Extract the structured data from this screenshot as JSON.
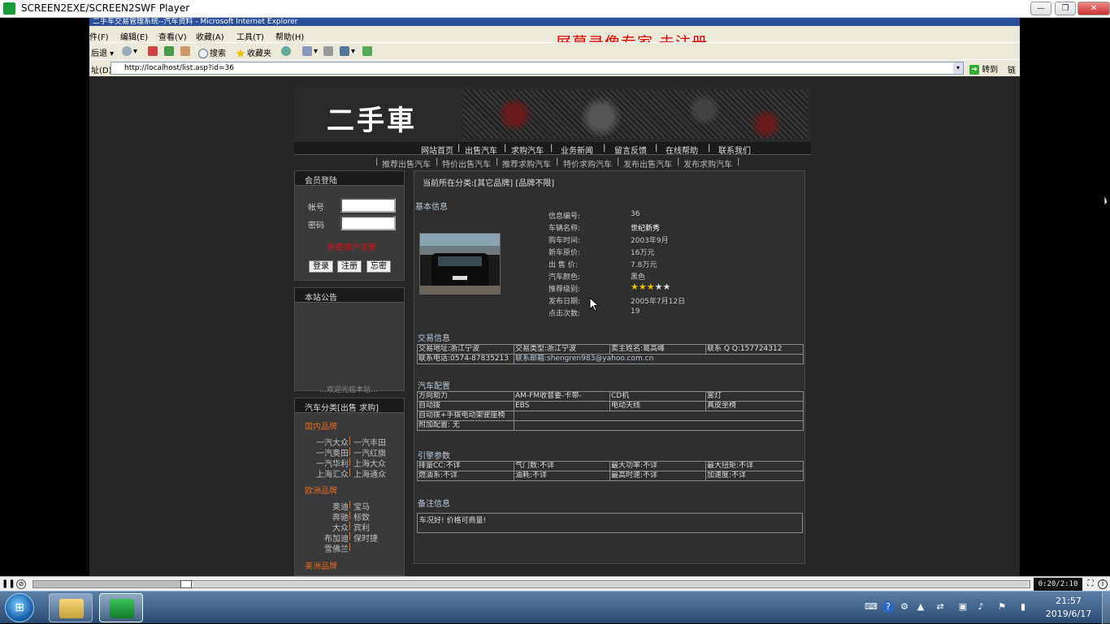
{
  "player": {
    "title": "SCREEN2EXE/SCREEN2SWF Player",
    "timecode": "0:20/2:10",
    "progress_fraction": 0.153
  },
  "ie": {
    "title": "二手车交易管理系统--汽车资料 - Microsoft Internet Explorer",
    "menus": [
      "件(F)",
      "编辑(E)",
      "查看(V)",
      "收藏(A)",
      "工具(T)",
      "帮助(H)"
    ],
    "watermark": "屏幕录像专家  未注册",
    "toolbar": {
      "back": "后退",
      "search": "搜索",
      "favorites": "收藏夹"
    },
    "address_label": "址(D)",
    "url": "http://localhost/list.asp?id=36",
    "go": "转到",
    "links": "链"
  },
  "site": {
    "logo": "二手車",
    "nav_main": [
      "网站首页",
      "|",
      "出售汽车",
      "|",
      "求购汽车",
      "|",
      "业务新闻",
      "|",
      "留言反馈",
      "|",
      "在线帮助",
      "|",
      "联系我们"
    ],
    "nav_sub": [
      "|",
      "推荐出售汽车",
      "|",
      "特价出售汽车",
      "|",
      "推荐求购汽车",
      "|",
      "特价求购汽车",
      "|",
      "发布出售汽车",
      "|",
      "发布求购汽车",
      "|"
    ],
    "login": {
      "title": "会员登陆",
      "user_label": "帐号",
      "pass_label": "密码",
      "register_link": "免费用户注册",
      "login_btn": "登录",
      "register_btn": "注册",
      "forgot_btn": "忘密"
    },
    "notice": {
      "title": "本站公告",
      "scroll_text": "…欢迎光临本站…"
    },
    "categories": {
      "title": "汽车分类[出售 求购]",
      "groups": [
        {
          "name": "国内品牌",
          "pairs": [
            [
              "一汽大众",
              "一汽丰田"
            ],
            [
              "一汽奥田",
              "一汽红旗"
            ],
            [
              "一汽华利",
              "上海大众"
            ],
            [
              "上海汇众",
              "上海通众"
            ]
          ]
        },
        {
          "name": "欧洲品牌",
          "pairs": [
            [
              "奥迪",
              "宝马"
            ],
            [
              "奔驰",
              "标致"
            ],
            [
              "大众",
              "宾利"
            ],
            [
              "布加迪",
              "保时捷"
            ],
            [
              "雪佛兰",
              ""
            ]
          ]
        },
        {
          "name": "美洲品牌",
          "pairs": []
        }
      ]
    },
    "content": {
      "breadcrumb": "当前所在分类:[其它品牌] [品牌不限]",
      "basic_title": "基本信息",
      "basic": [
        {
          "k": "信息编号:",
          "v": "36"
        },
        {
          "k": "车辆名称:",
          "v": "世纪新秀"
        },
        {
          "k": "购车时间:",
          "v": "2003年9月"
        },
        {
          "k": "新车原价:",
          "v": "16万元"
        },
        {
          "k": "出 售 价:",
          "v": "7.8万元"
        },
        {
          "k": "汽车颜色:",
          "v": "黑色"
        },
        {
          "k": "推荐级别:",
          "v": ""
        },
        {
          "k": "发布日期:",
          "v": "2005年7月12日"
        },
        {
          "k": "点击次数:",
          "v": "19"
        }
      ],
      "rating": 3,
      "rating_max": 5,
      "trade_title": "交易信息",
      "trade_rows": [
        [
          "交易地址:浙江宁波",
          "交易类型:浙江宁波",
          "卖主姓名:葛高峰",
          "联系 Q Q:157724312"
        ],
        [
          "联系电话:0574-87835213",
          "联系邮箱:shengren983@yahoo.com.cn"
        ]
      ],
      "config_title": "汽车配置",
      "config_rows": [
        [
          "方向助力",
          "AM-FM收音要-卡带-",
          "CD机",
          "雾灯"
        ],
        [
          "自动拨",
          "EBS",
          "电动天线",
          "真皮坐椅"
        ],
        [
          "自动拨+手拨电动架驶座椅",
          "",
          "",
          ""
        ],
        [
          "附加配置: 无",
          "",
          "",
          ""
        ]
      ],
      "engine_title": "引擎参数",
      "engine_rows": [
        [
          "排量CC:不详",
          "气门数:不详",
          "最大功率:不详",
          "最大扭矩:不详"
        ],
        [
          "燃油系:不详",
          "油耗:不详",
          "最高时速:不详",
          "加速度:不详"
        ]
      ],
      "remark_title": "备注信息",
      "remark": "车况好!  价格可商量!"
    }
  },
  "taskbar": {
    "time": "21:57",
    "date": "2019/6/17"
  }
}
